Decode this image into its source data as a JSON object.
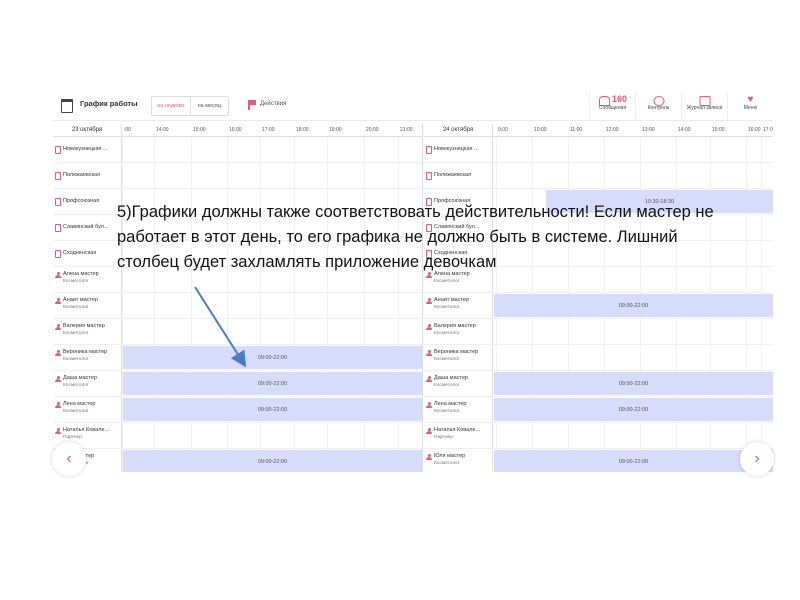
{
  "header": {
    "title": "График работы",
    "view_week": "на неделю",
    "view_month": "на месяц",
    "actions": "Действия",
    "buttons": [
      {
        "icon": "bell-icon",
        "count": "160",
        "label": "Сообщения"
      },
      {
        "icon": "gauge-icon",
        "label": "Контроль"
      },
      {
        "icon": "journal-icon",
        "label": "Журнал записи"
      },
      {
        "icon": "heart-icon",
        "label": "Меню"
      }
    ]
  },
  "days": [
    {
      "date": "23 октября",
      "ticks": [
        ":00",
        "14:00",
        "15:00",
        "16:00",
        "17:00",
        "18:00",
        "19:00",
        "20:00",
        "21:00"
      ],
      "rows": [
        {
          "name": "Новокузнецкая ...",
          "role": "",
          "type": "branch",
          "shift": ""
        },
        {
          "name": "Полежаевская",
          "role": "",
          "type": "branch",
          "shift": ""
        },
        {
          "name": "Профсоюзная",
          "role": "",
          "type": "branch",
          "shift": ""
        },
        {
          "name": "Славянский бул...",
          "role": "",
          "type": "branch",
          "shift": ""
        },
        {
          "name": "Сходненская",
          "role": "",
          "type": "branch",
          "shift": ""
        },
        {
          "name": "Алена мастер",
          "role": "Косметолог",
          "type": "person",
          "shift": ""
        },
        {
          "name": "Анаит мастер",
          "role": "Косметолог",
          "type": "person",
          "shift": ""
        },
        {
          "name": "Валерия мастер",
          "role": "Косметолог",
          "type": "person",
          "shift": ""
        },
        {
          "name": "Вероника мастер",
          "role": "Косметолог",
          "type": "person",
          "shift": "09:00-22:00"
        },
        {
          "name": "Даша мастер",
          "role": "Косметолог",
          "type": "person",
          "shift": "09:00-22:00"
        },
        {
          "name": "Лена мастер",
          "role": "Косметолог",
          "type": "person",
          "shift": "09:00-22:00"
        },
        {
          "name": "Наталья Ковале...",
          "role": "Партнер",
          "type": "person",
          "shift": ""
        },
        {
          "name": "Юля мастер",
          "role": "Косметолог",
          "type": "person",
          "shift": "09:00-22:00"
        }
      ]
    },
    {
      "date": "24 октября",
      "ticks": [
        "9:00",
        "10:00",
        "11:00",
        "12:00",
        "13:00",
        "14:00",
        "15:00",
        "16:00",
        "17:00"
      ],
      "rows": [
        {
          "name": "Новокузнецкая ...",
          "role": "",
          "type": "branch",
          "shift": ""
        },
        {
          "name": "Полежаевская",
          "role": "",
          "type": "branch",
          "shift": ""
        },
        {
          "name": "Профсоюзная",
          "role": "",
          "type": "branch",
          "shift": "10:30-18:30"
        },
        {
          "name": "Славянский бул...",
          "role": "",
          "type": "branch",
          "shift": ""
        },
        {
          "name": "Сходненская",
          "role": "",
          "type": "branch",
          "shift": ""
        },
        {
          "name": "Алена мастер",
          "role": "Косметолог",
          "type": "person",
          "shift": ""
        },
        {
          "name": "Анаит мастер",
          "role": "Косметолог",
          "type": "person",
          "shift": "09:00-22:00"
        },
        {
          "name": "Валерия мастер",
          "role": "Косметолог",
          "type": "person",
          "shift": ""
        },
        {
          "name": "Вероника мастер",
          "role": "Косметолог",
          "type": "person",
          "shift": ""
        },
        {
          "name": "Даша мастер",
          "role": "Косметолог",
          "type": "person",
          "shift": "09:00-22:00"
        },
        {
          "name": "Лена мастер",
          "role": "Косметолог",
          "type": "person",
          "shift": "09:00-22:00"
        },
        {
          "name": "Наталья Ковале...",
          "role": "Партнер",
          "type": "person",
          "shift": ""
        },
        {
          "name": "Юля мастер",
          "role": "Косметолог",
          "type": "person",
          "shift": "09:00-22:00"
        }
      ]
    }
  ],
  "annotation": "5)Графики должны также соответствовать  действительности! Если мастер не работает в этот день, то его графика не должно быть в системе. Лишний столбец будет захламлять приложение девочкам",
  "colors": {
    "accent": "#e45b7b",
    "shift_fill": "#d7dcfb",
    "arrow": "#4a7bc4"
  }
}
